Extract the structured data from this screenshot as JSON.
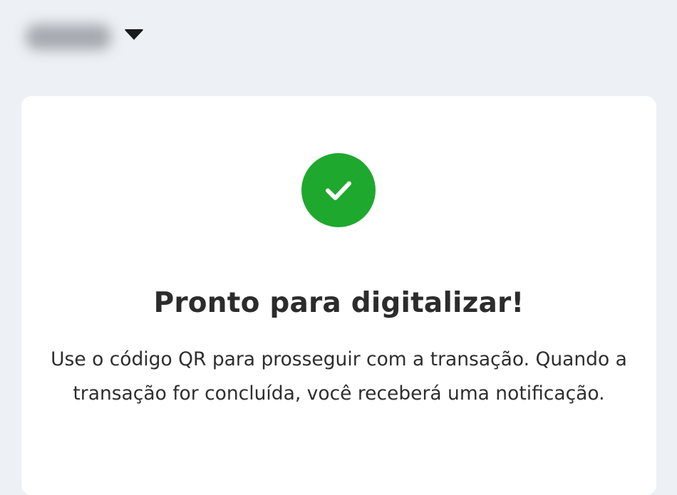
{
  "header": {
    "account_selector": {
      "icon": "chevron-down-icon"
    }
  },
  "status": {
    "icon": "checkmark-icon",
    "color": "#1fa82e",
    "title": "Pronto para digitalizar!",
    "message": "Use o código QR para prosseguir com a transação. Quando a transação for concluída, você receberá uma notificação."
  }
}
